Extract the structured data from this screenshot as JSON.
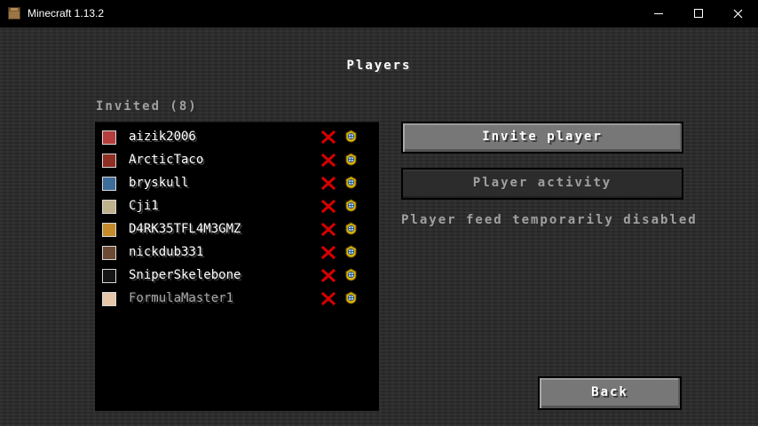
{
  "window": {
    "title": "Minecraft 1.13.2",
    "app_icon": "crafting-table-icon"
  },
  "page": {
    "title": "Players",
    "section_title": "Invited (8)"
  },
  "players": [
    {
      "name": "aizik2006",
      "avatar_color": "#b53d3d",
      "dim": false
    },
    {
      "name": "ArcticTaco",
      "avatar_color": "#8f2e22",
      "dim": false
    },
    {
      "name": "bryskull",
      "avatar_color": "#3d6d9a",
      "dim": false
    },
    {
      "name": "Cji1",
      "avatar_color": "#c0b18d",
      "dim": false
    },
    {
      "name": "D4RK35TFL4M3GMZ",
      "avatar_color": "#c58b2a",
      "dim": false
    },
    {
      "name": "nickdub331",
      "avatar_color": "#6d4a35",
      "dim": false
    },
    {
      "name": "SniperSkelebone",
      "avatar_color": "#151515",
      "dim": false
    },
    {
      "name": "FormulaMaster1",
      "avatar_color": "#e6c6a8",
      "dim": true
    }
  ],
  "buttons": {
    "invite": "Invite player",
    "activity": "Player activity",
    "back": "Back"
  },
  "feed_status": "Player feed temporarily disabled",
  "colors": {
    "remove_icon": "#d70000",
    "operator_icon": "#e0b400",
    "button_face": "#777777",
    "disabled_button": "#2c2c2c"
  },
  "icons": {
    "remove": "red-x-icon",
    "operator": "operator-shield-icon"
  }
}
